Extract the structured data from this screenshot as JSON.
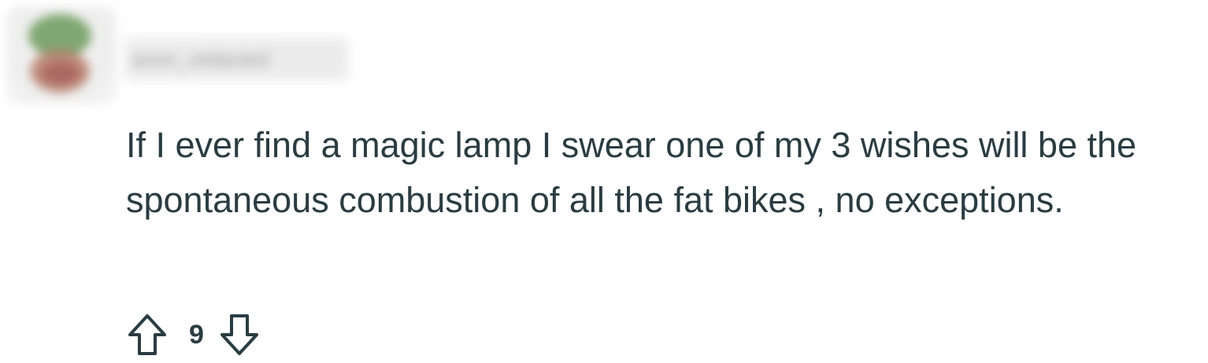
{
  "comment": {
    "author": "anon_redacted",
    "body": "If I ever find a magic lamp I swear one of my 3 wishes will be the spontaneous combustion of all the fat bikes , no exceptions.",
    "votes": "9"
  },
  "icons": {
    "upvote": "arrow-up-outline-icon",
    "downvote": "arrow-down-outline-icon"
  },
  "colors": {
    "text": "#2a3c42",
    "background": "#ffffff"
  }
}
